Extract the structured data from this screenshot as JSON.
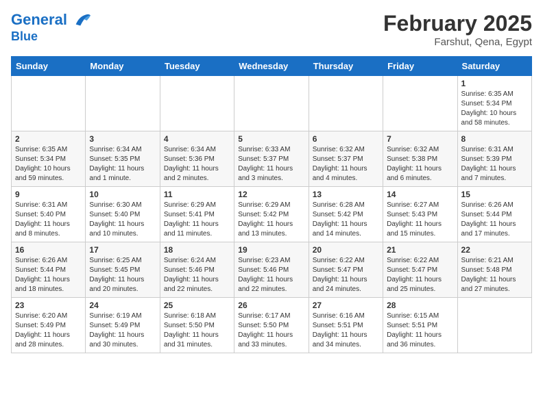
{
  "header": {
    "logo_line1": "General",
    "logo_line2": "Blue",
    "month_title": "February 2025",
    "location": "Farshut, Qena, Egypt"
  },
  "days_of_week": [
    "Sunday",
    "Monday",
    "Tuesday",
    "Wednesday",
    "Thursday",
    "Friday",
    "Saturday"
  ],
  "weeks": [
    [
      {
        "day": "",
        "info": ""
      },
      {
        "day": "",
        "info": ""
      },
      {
        "day": "",
        "info": ""
      },
      {
        "day": "",
        "info": ""
      },
      {
        "day": "",
        "info": ""
      },
      {
        "day": "",
        "info": ""
      },
      {
        "day": "1",
        "info": "Sunrise: 6:35 AM\nSunset: 5:34 PM\nDaylight: 10 hours and 58 minutes."
      }
    ],
    [
      {
        "day": "2",
        "info": "Sunrise: 6:35 AM\nSunset: 5:34 PM\nDaylight: 10 hours and 59 minutes."
      },
      {
        "day": "3",
        "info": "Sunrise: 6:34 AM\nSunset: 5:35 PM\nDaylight: 11 hours and 1 minute."
      },
      {
        "day": "4",
        "info": "Sunrise: 6:34 AM\nSunset: 5:36 PM\nDaylight: 11 hours and 2 minutes."
      },
      {
        "day": "5",
        "info": "Sunrise: 6:33 AM\nSunset: 5:37 PM\nDaylight: 11 hours and 3 minutes."
      },
      {
        "day": "6",
        "info": "Sunrise: 6:32 AM\nSunset: 5:37 PM\nDaylight: 11 hours and 4 minutes."
      },
      {
        "day": "7",
        "info": "Sunrise: 6:32 AM\nSunset: 5:38 PM\nDaylight: 11 hours and 6 minutes."
      },
      {
        "day": "8",
        "info": "Sunrise: 6:31 AM\nSunset: 5:39 PM\nDaylight: 11 hours and 7 minutes."
      }
    ],
    [
      {
        "day": "9",
        "info": "Sunrise: 6:31 AM\nSunset: 5:40 PM\nDaylight: 11 hours and 8 minutes."
      },
      {
        "day": "10",
        "info": "Sunrise: 6:30 AM\nSunset: 5:40 PM\nDaylight: 11 hours and 10 minutes."
      },
      {
        "day": "11",
        "info": "Sunrise: 6:29 AM\nSunset: 5:41 PM\nDaylight: 11 hours and 11 minutes."
      },
      {
        "day": "12",
        "info": "Sunrise: 6:29 AM\nSunset: 5:42 PM\nDaylight: 11 hours and 13 minutes."
      },
      {
        "day": "13",
        "info": "Sunrise: 6:28 AM\nSunset: 5:42 PM\nDaylight: 11 hours and 14 minutes."
      },
      {
        "day": "14",
        "info": "Sunrise: 6:27 AM\nSunset: 5:43 PM\nDaylight: 11 hours and 15 minutes."
      },
      {
        "day": "15",
        "info": "Sunrise: 6:26 AM\nSunset: 5:44 PM\nDaylight: 11 hours and 17 minutes."
      }
    ],
    [
      {
        "day": "16",
        "info": "Sunrise: 6:26 AM\nSunset: 5:44 PM\nDaylight: 11 hours and 18 minutes."
      },
      {
        "day": "17",
        "info": "Sunrise: 6:25 AM\nSunset: 5:45 PM\nDaylight: 11 hours and 20 minutes."
      },
      {
        "day": "18",
        "info": "Sunrise: 6:24 AM\nSunset: 5:46 PM\nDaylight: 11 hours and 22 minutes."
      },
      {
        "day": "19",
        "info": "Sunrise: 6:23 AM\nSunset: 5:46 PM\nDaylight: 11 hours and 22 minutes."
      },
      {
        "day": "20",
        "info": "Sunrise: 6:22 AM\nSunset: 5:47 PM\nDaylight: 11 hours and 24 minutes."
      },
      {
        "day": "21",
        "info": "Sunrise: 6:22 AM\nSunset: 5:47 PM\nDaylight: 11 hours and 25 minutes."
      },
      {
        "day": "22",
        "info": "Sunrise: 6:21 AM\nSunset: 5:48 PM\nDaylight: 11 hours and 27 minutes."
      }
    ],
    [
      {
        "day": "23",
        "info": "Sunrise: 6:20 AM\nSunset: 5:49 PM\nDaylight: 11 hours and 28 minutes."
      },
      {
        "day": "24",
        "info": "Sunrise: 6:19 AM\nSunset: 5:49 PM\nDaylight: 11 hours and 30 minutes."
      },
      {
        "day": "25",
        "info": "Sunrise: 6:18 AM\nSunset: 5:50 PM\nDaylight: 11 hours and 31 minutes."
      },
      {
        "day": "26",
        "info": "Sunrise: 6:17 AM\nSunset: 5:50 PM\nDaylight: 11 hours and 33 minutes."
      },
      {
        "day": "27",
        "info": "Sunrise: 6:16 AM\nSunset: 5:51 PM\nDaylight: 11 hours and 34 minutes."
      },
      {
        "day": "28",
        "info": "Sunrise: 6:15 AM\nSunset: 5:51 PM\nDaylight: 11 hours and 36 minutes."
      },
      {
        "day": "",
        "info": ""
      }
    ]
  ]
}
